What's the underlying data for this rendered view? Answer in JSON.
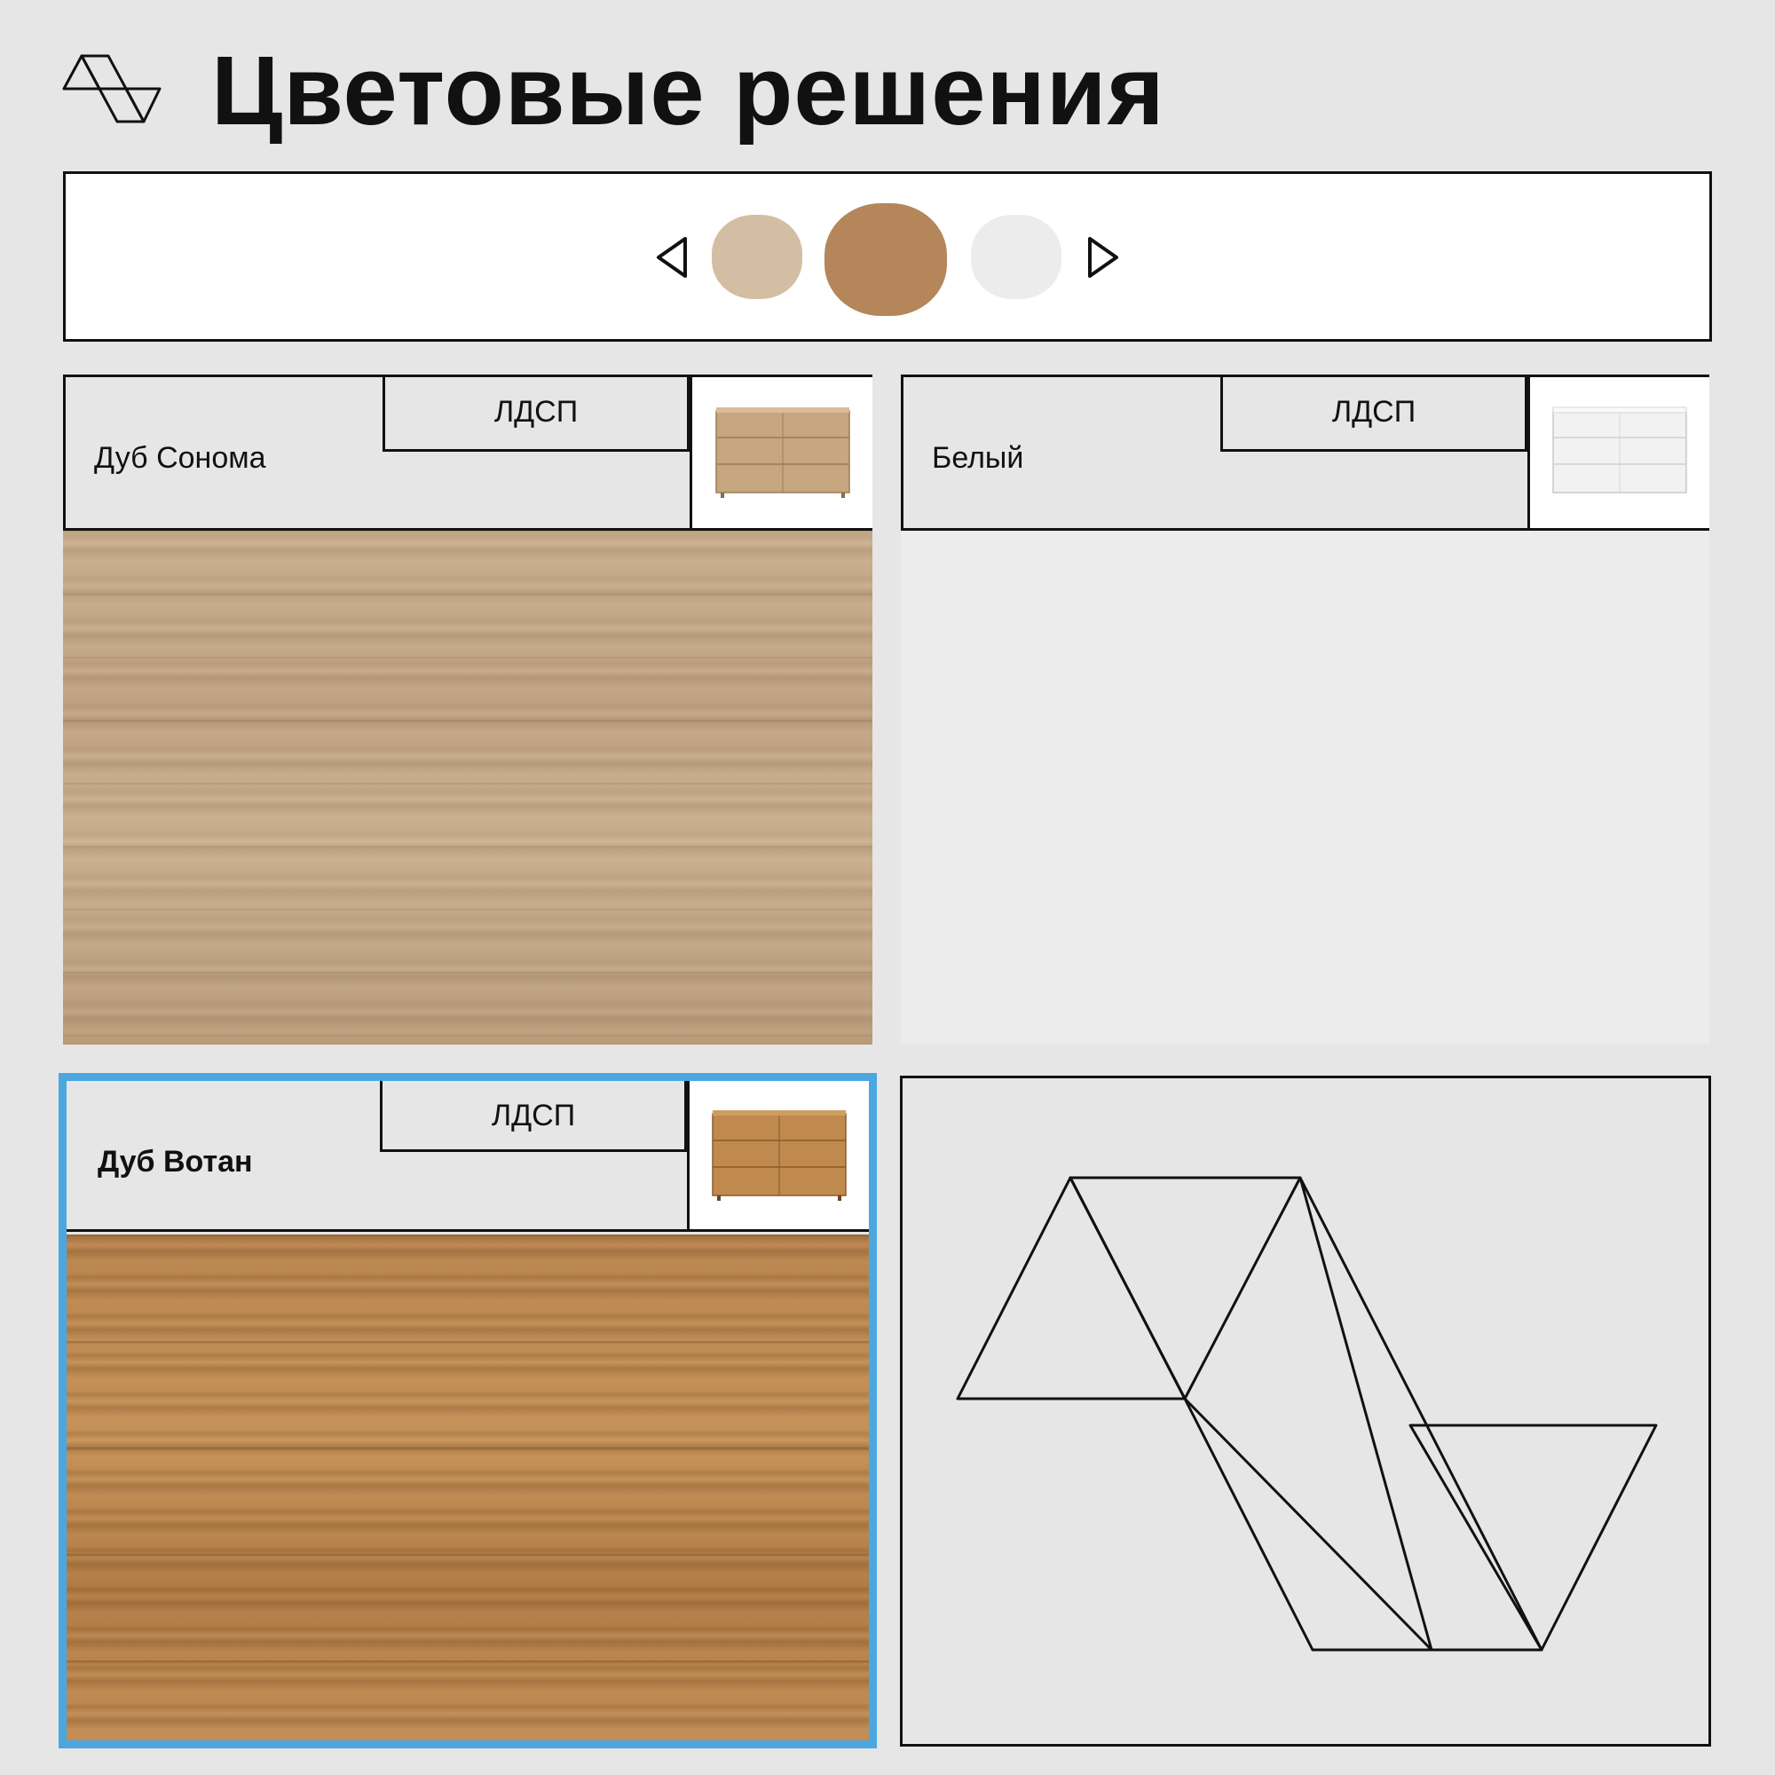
{
  "header": {
    "title": "Цветовые решения",
    "logo_icon": "triangles-logo-icon"
  },
  "swatch_bar": {
    "prev_icon": "triangle-left-icon",
    "next_icon": "triangle-right-icon",
    "swatches": [
      {
        "name": "Дуб Сонома",
        "color": "#d4bea3",
        "selected": false
      },
      {
        "name": "Дуб Вотан",
        "color": "#b4865a",
        "selected": true
      },
      {
        "name": "Белый",
        "color": "#ececec",
        "selected": false
      }
    ]
  },
  "cards": [
    {
      "name": "Дуб Сонома",
      "material": "ЛДСП",
      "selected": false
    },
    {
      "name": "Белый",
      "material": "ЛДСП",
      "selected": false
    },
    {
      "name": "Дуб Вотан",
      "material": "ЛДСП",
      "selected": true
    }
  ],
  "colors": {
    "selection_border": "#4ba7e0",
    "line": "#111111",
    "background": "#e6e6e6"
  }
}
